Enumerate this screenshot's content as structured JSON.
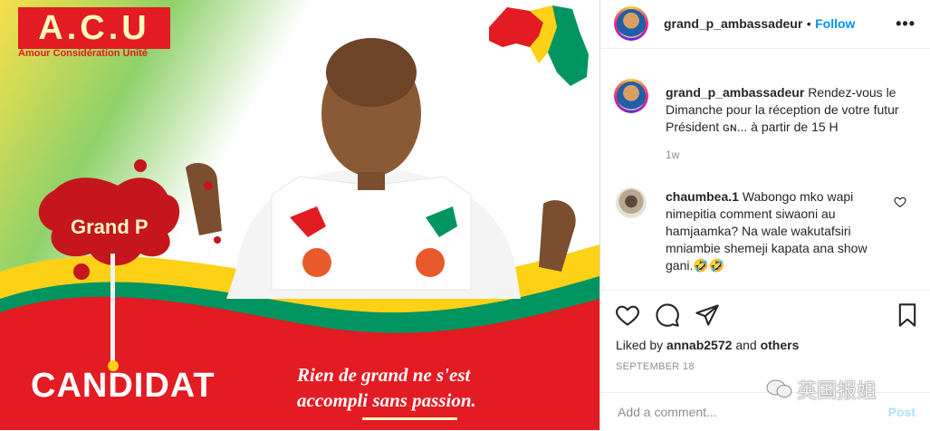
{
  "poster": {
    "brand": "A.C.U",
    "brand_subtitle": "Amour Considération Unité",
    "stain_label": "Grand P",
    "headline": "CANDIDAT",
    "slogan_line1": "Rien de grand ne s'est",
    "slogan_line2": "accompli sans passion.",
    "colors": {
      "red": "#e31b23",
      "yellow": "#fcd116",
      "green": "#009460"
    }
  },
  "header": {
    "username": "grand_p_ambassadeur",
    "separator": "•",
    "follow_label": "Follow",
    "more_icon": "more-horizontal-icon"
  },
  "caption": {
    "username": "grand_p_ambassadeur",
    "text": "Rendez-vous le Dimanche pour la réception de votre futur Président ɢɴ... à partir de 15 H",
    "time": "1w"
  },
  "comments": [
    {
      "username": "chaumbea.1",
      "text": "Wabongo mko wapi nimepitia comment siwaoni au hamjaamka? Na wale wakutafsiri mniambie shemeji kapata ana show gani.🤣🤣"
    }
  ],
  "actions": {
    "icons": [
      "heart-icon",
      "comment-icon",
      "share-icon",
      "bookmark-icon"
    ],
    "liked_by_prefix": "Liked by",
    "liked_by_user": "annab2572",
    "liked_by_and": "and",
    "liked_by_others": "others",
    "date": "SEPTEMBER 18"
  },
  "add_comment": {
    "placeholder": "Add a comment...",
    "post_label": "Post"
  },
  "watermark": {
    "text": "英国报姐"
  }
}
